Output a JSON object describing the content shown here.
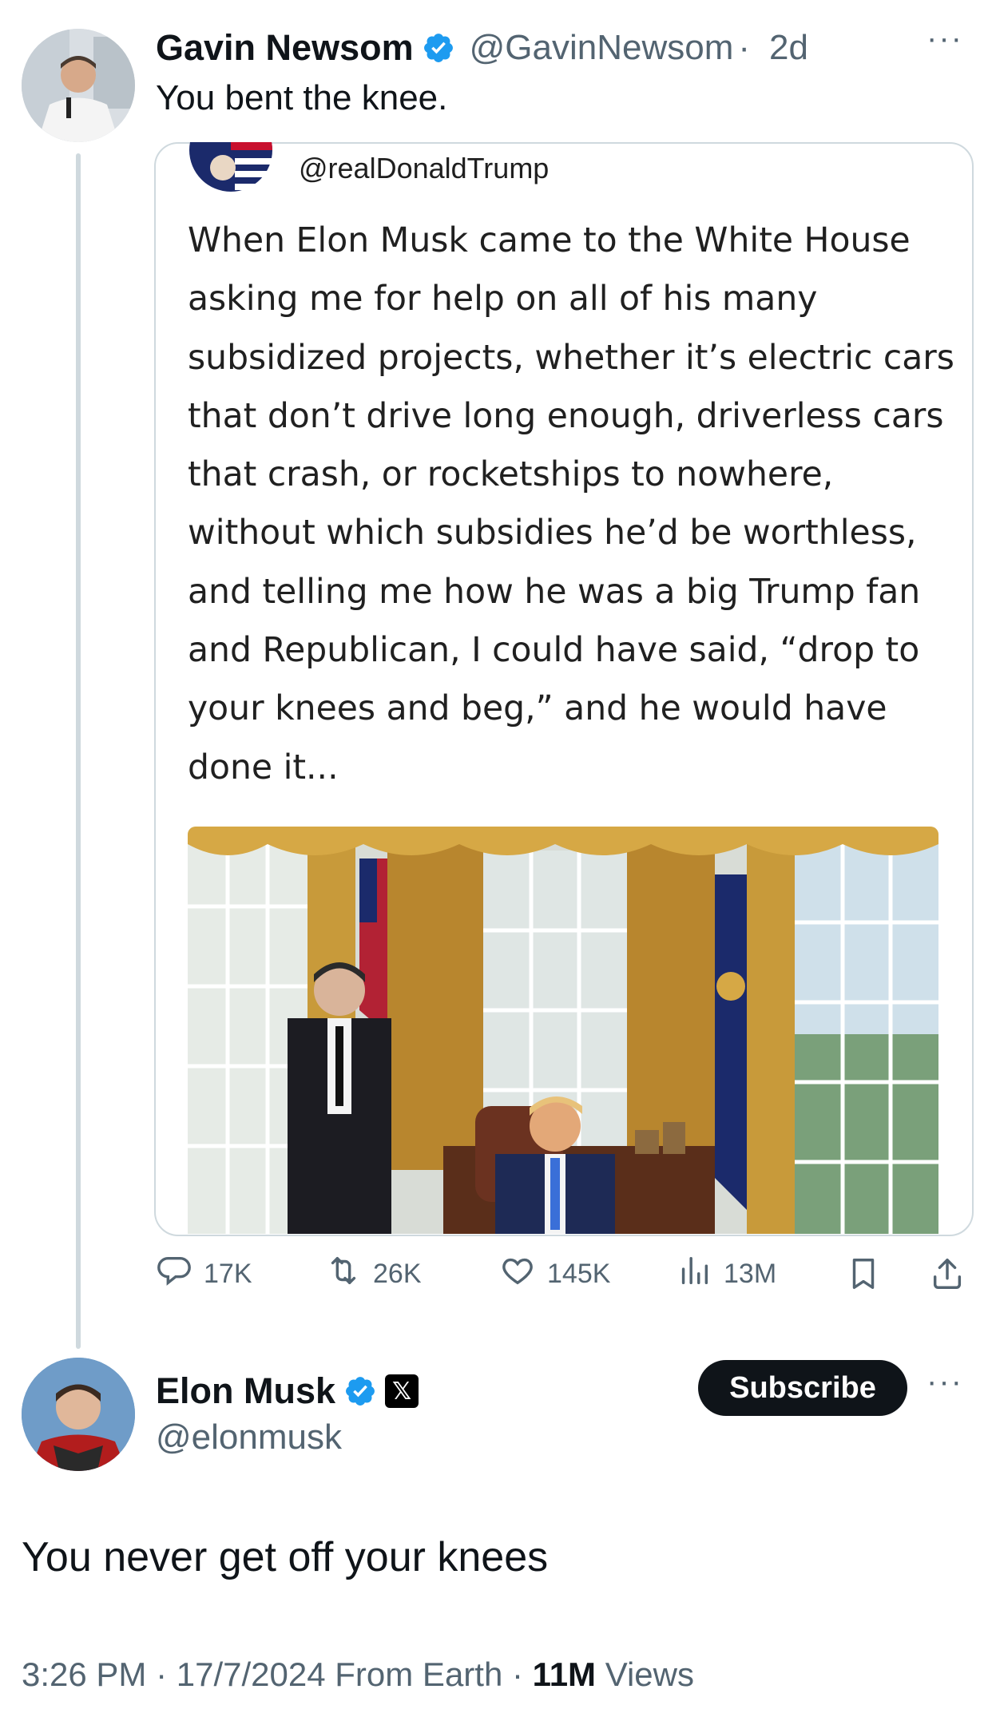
{
  "tweet": {
    "author_name": "Gavin Newsom",
    "author_handle": "@GavinNewsom",
    "separator": "·",
    "time_ago": "2d",
    "more_label": "···",
    "text": "You bent the knee.",
    "quote": {
      "handle": "@realDonaldTrump",
      "body": "When Elon Musk came to the White House asking me for help on all of his many subsidized projects, whether it’s electric cars that don’t drive long enough, driverless cars that crash, or rocketships to nowhere, without which subsidies he’d be worthless, and telling me how he was a big Trump fan and Republican, I could have said, “drop to your knees and beg,” and he would have done it..."
    },
    "actions": {
      "replies": "17K",
      "reposts": "26K",
      "likes": "145K",
      "views": "13M"
    }
  },
  "reply": {
    "author_name": "Elon Musk",
    "author_handle": "@elonmusk",
    "x_badge": "𝕏",
    "subscribe_label": "Subscribe",
    "more_label": "···",
    "text": "You never get off your knees",
    "time": "3:26 PM",
    "sep1": " · ",
    "date": "17/7/2024",
    "source": " From Earth",
    "sep2": " · ",
    "views_count": "11M",
    "views_label": " Views"
  },
  "colors": {
    "verified": "#1d9bf0",
    "secondary_text": "#536471",
    "primary_text": "#0f1419",
    "border": "#cfd9de"
  },
  "icons": [
    "reply-icon",
    "repost-icon",
    "like-icon",
    "views-icon",
    "bookmark-icon",
    "share-icon",
    "verified-badge-icon",
    "x-logo-icon",
    "more-icon"
  ]
}
